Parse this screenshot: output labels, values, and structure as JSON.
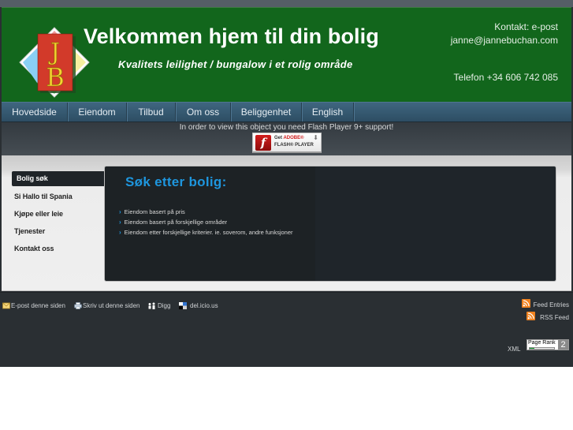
{
  "header": {
    "title": "Velkommen hjem til din bolig",
    "subtitle": "Kvalitets leilighet / bungalow i et rolig område",
    "logo_letters": [
      "J",
      "B"
    ],
    "contact_label": "Kontakt: e-post",
    "contact_email": "janne@jannebuchan.com",
    "contact_phone": "Telefon +34 606 742 085"
  },
  "nav": {
    "items": [
      {
        "label": "Hovedside"
      },
      {
        "label": "Eiendom"
      },
      {
        "label": "Tilbud"
      },
      {
        "label": "Om oss"
      },
      {
        "label": "Beliggenhet"
      },
      {
        "label": "English"
      }
    ]
  },
  "flash": {
    "message": "In order to view this object you need Flash Player 9+ support!",
    "badge_get": "Get",
    "badge_adobe": "ADOBE®",
    "badge_product": "FLASH® PLAYER",
    "icon_glyph": "f"
  },
  "sidebar": {
    "items": [
      {
        "label": "Bolig søk",
        "active": true
      },
      {
        "label": "Si Hallo til Spania"
      },
      {
        "label": "Kjøpe eller leie"
      },
      {
        "label": "Tjenester"
      },
      {
        "label": "Kontakt oss"
      }
    ]
  },
  "main": {
    "title": "Søk etter bolig:",
    "bullet": "›",
    "links": [
      {
        "label": "Eiendom basert på pris"
      },
      {
        "label": "Eiendom basert på forskjellige områder"
      },
      {
        "label": "Eiendom etter forskjellige kriterier. ie. soverom, andre funksjoner"
      }
    ]
  },
  "footer": {
    "share": [
      {
        "label": "E-post denne siden",
        "icon": "envelope-icon"
      },
      {
        "label": "Skriv ut denne siden",
        "icon": "printer-icon"
      },
      {
        "label": "Digg",
        "icon": "digg-icon"
      },
      {
        "label": "del.icio.us",
        "icon": "delicious-icon"
      }
    ],
    "feed_entries": "Feed Entries",
    "rss_feed": "RSS Feed",
    "xml_label": "XML",
    "pagerank": {
      "label": "Page Rank",
      "value": "2",
      "fill_fraction": 0.2
    }
  },
  "colors": {
    "header_green": "#12661c",
    "nav_blue": "#3f6680",
    "accent_blue": "#1e96de",
    "panel_dark": "#1f252a",
    "rss_orange": "#f0821f"
  }
}
